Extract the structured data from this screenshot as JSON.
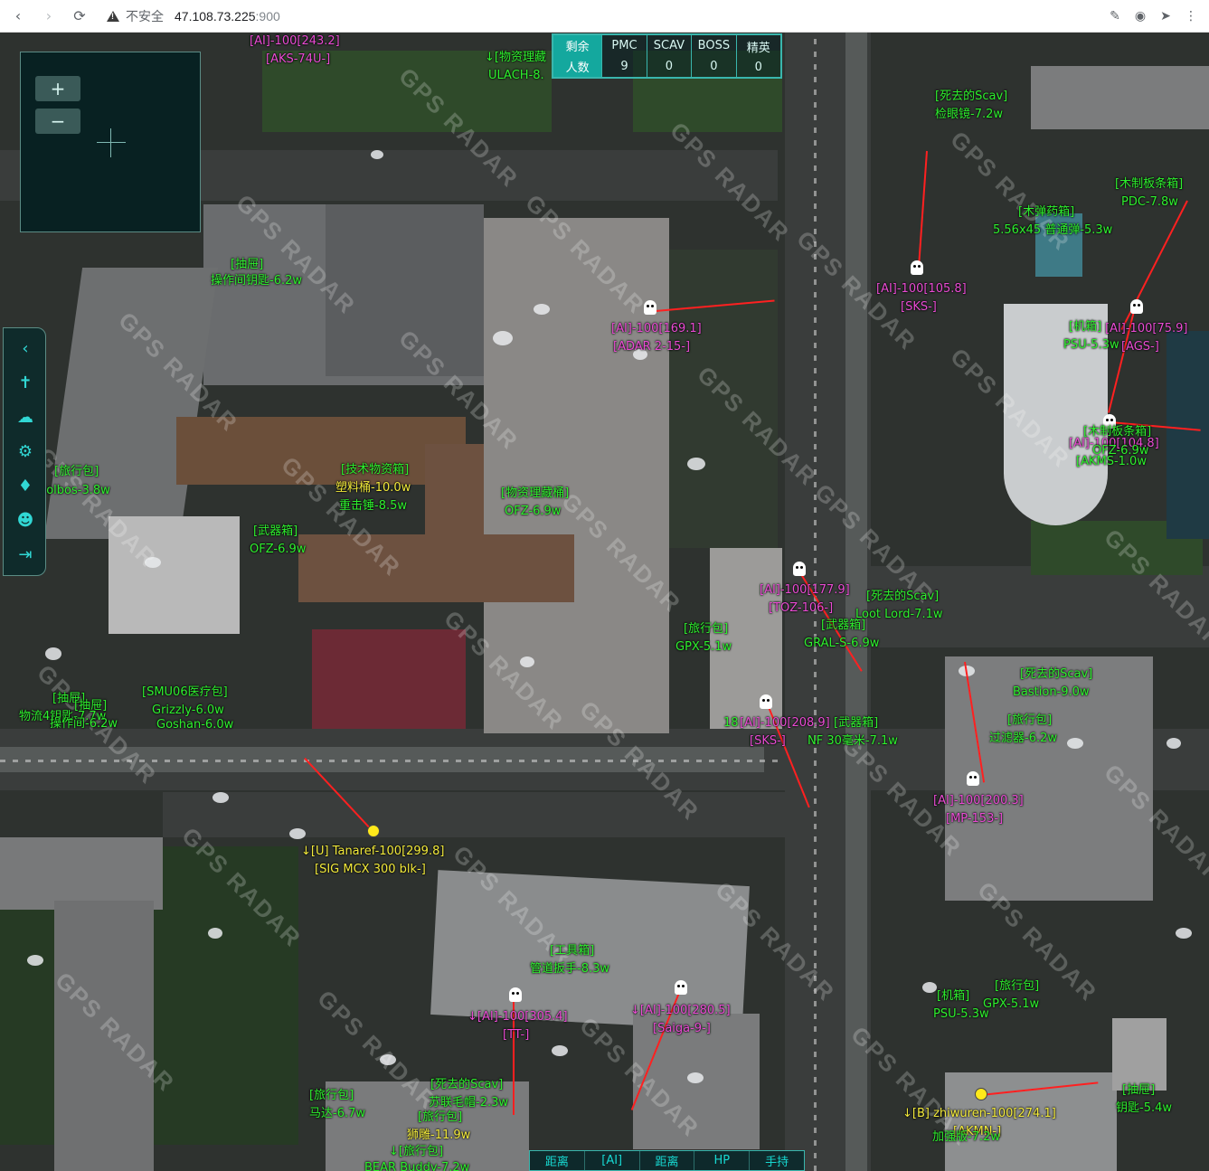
{
  "browser": {
    "insecure_label": "不安全",
    "url_host": "47.108.73.225",
    "url_port": ":900"
  },
  "counter": {
    "row1_label": "剩余",
    "row2_label": "人数",
    "columns": [
      {
        "label": "PMC",
        "value": "9"
      },
      {
        "label": "SCAV",
        "value": "0"
      },
      {
        "label": "BOSS",
        "value": "0"
      },
      {
        "label": "精英",
        "value": "0"
      }
    ]
  },
  "minimap": {
    "zoom_in": "+",
    "zoom_out": "−"
  },
  "sidebar": {
    "icons": [
      "chevron-left-icon",
      "person-icon",
      "cloud-icon",
      "gear-icon",
      "diamond-icon",
      "mask-icon",
      "logout-icon"
    ]
  },
  "watermark_text": "GPS RADAR",
  "bottom_bar": [
    "距离",
    "[AI]",
    "距离",
    "HP",
    "手持"
  ],
  "colors": {
    "accent": "#39b6ad",
    "loot": "#2ef02e",
    "ai": "#e94bd3",
    "player": "#f2ea3b",
    "line": "#ff2020"
  },
  "labels": {
    "ai_top": "[AI]-100[243.2]",
    "ai_top_w": "[AKS-74U-]",
    "ulach_box": "↓[物资理藏",
    "ulach": "ULACH-8.",
    "scav_dead_1": "[死去的Scav]",
    "scav_dead_1_item": "检眼镜-7.2w",
    "wood_box_1": "[木制板条箱]",
    "wood_box_1_item": "PDC-7.8w",
    "med_box": "[木弹药箱]",
    "med_box_item": "5.56x45 普通弹-5.3w",
    "ai_105": "[AI]-100[105.8]",
    "ai_105_w": "[SKS-]",
    "drawer_1": "[抽屉]",
    "drawer_1_item": "操作间钥匙-6.2w",
    "ai_169": "[AI]-100[169.1]",
    "ai_169_w": "[ADAR 2-15-]",
    "psu_box": "[机箱]",
    "psu_item": "PSU-5.3w",
    "ai_75": "[AI]-100[75.9]",
    "ai_75_w": "[AGS-]",
    "wood_box_2": "[木制板条箱]",
    "ai_104": "[AI]-100[104.8]",
    "ai_104_item": "OFZ-6.9w",
    "ai_104_w": "[AKMS-1.0w",
    "bag_1": "[旅行包]",
    "bag_1_item": "Molbos-3.8w",
    "tech_box": "[技术物资箱]",
    "tech_item_1": "塑料桶-10.0w",
    "tech_item_2": "重击锤-8.5w",
    "cache_2": "[物资理藏桶]",
    "cache_2_item": "OFZ-6.9w",
    "weapon_box_1": "[武器箱]",
    "weapon_box_1_item": "OFZ-6.9w",
    "ai_177": "[AI]-100[177.9]",
    "ai_177_w": "[TOZ-106-]",
    "scav_dead_2": "[死去的Scav]",
    "scav_dead_2_item": "Loot Lord-7.1w",
    "weapon_box_2": "[武器箱]",
    "weapon_box_2_item": "GRAL-S-6.9w",
    "bag_2": "[旅行包]",
    "bag_2_item": "GPX-5.1w",
    "drawer_2": "[抽屉]",
    "drawer_2_a": "[抽屉]",
    "drawer_2_item_1": "物流4钥匙-7.7w",
    "drawer_2_item_2": "操作间-6.2w",
    "med_bag": "[SMU06医疗包]",
    "med_bag_item_1": "Grizzly-6.0w",
    "med_bag_item_2": "Goshan-6.0w",
    "ai_208": "[AI]-100[208.9]",
    "ai_208_w": "[SKS-]",
    "ai_208_pre": "18",
    "weapon_box_3": "[武器箱]",
    "weapon_box_3_item": "NF 30毫米-7.1w",
    "scav_dead_3": "[死去的Scav]",
    "scav_dead_3_item": "Bastion-9.0w",
    "bag_3": "[旅行包]",
    "bag_3_item": "过滤器-6.2w",
    "ai_200": "[AI]-100[200.3]",
    "ai_200_w": "[MP-153-]",
    "player_u": "↓[U] Tanaref-100[299.8]",
    "player_u_w": "[SIG MCX 300 blk-]",
    "tool_box": "[工具箱]",
    "tool_box_item": "管道扳手-8.3w",
    "ai_305": "↓[AI]-100[305.4]",
    "ai_305_w": "[TT-]",
    "ai_280": "↓[AI]-100[280.5]",
    "ai_280_w": "[Saiga-9-]",
    "bag_4": "[旅行包]",
    "bag_4_item": "GPX-5.1w",
    "psu_box_2": "[机箱]",
    "psu_box_2_item": "PSU-5.3w",
    "bag_5": "[旅行包]",
    "bag_5_item": "马达-6.7w",
    "scav_dead_4": "[死去的Scav]",
    "scav_dead_4_item": "苏联毛帽-2.3w",
    "bag_6": "[旅行包]",
    "bag_6_item": "狮雕-11.9w",
    "bag_7": "↓[旅行包]",
    "bag_7_item": "BEAR Buddy-7.2w",
    "drawer_3": "[抽屉]",
    "drawer_3_item": "钥匙-5.4w",
    "player_b": "↓[B] zhiwuren-100[274.1]",
    "player_b_w": "[AKMN-]",
    "player_b_item": "加强版-7.2w",
    "chest_top": "↓[抽屉(Loot)]"
  }
}
